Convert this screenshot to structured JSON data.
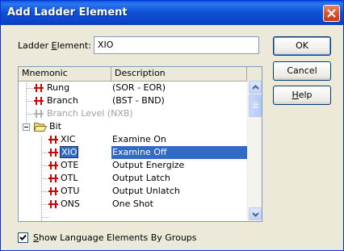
{
  "window": {
    "title": "Add Ladder Element"
  },
  "field": {
    "label_prefix": "Ladder ",
    "label_accel": "E",
    "label_suffix": "lement:",
    "value": "XIO"
  },
  "buttons": {
    "ok": "OK",
    "cancel": "Cancel",
    "help_accel": "H",
    "help_rest": "elp"
  },
  "list": {
    "col_mnemonic": "Mnemonic",
    "col_description": "Description",
    "rows": [
      {
        "mnemonic": "Rung",
        "description": "(SOR - EOR)",
        "enabled": true,
        "selected": false
      },
      {
        "mnemonic": "Branch",
        "description": "(BST - BND)",
        "enabled": true,
        "selected": false
      },
      {
        "mnemonic": "Branch Level (NXB)",
        "description": "",
        "enabled": false,
        "selected": false
      },
      {
        "mnemonic": "Bit",
        "description": "",
        "enabled": true,
        "selected": false,
        "folder": true
      },
      {
        "mnemonic": "XIC",
        "description": "Examine On",
        "enabled": true,
        "selected": false
      },
      {
        "mnemonic": "XIO",
        "description": "Examine Off",
        "enabled": true,
        "selected": true
      },
      {
        "mnemonic": "OTE",
        "description": "Output Energize",
        "enabled": true,
        "selected": false
      },
      {
        "mnemonic": "OTL",
        "description": "Output Latch",
        "enabled": true,
        "selected": false
      },
      {
        "mnemonic": "OTU",
        "description": "Output Unlatch",
        "enabled": true,
        "selected": false
      },
      {
        "mnemonic": "ONS",
        "description": "One Shot",
        "enabled": true,
        "selected": false
      }
    ]
  },
  "checkbox": {
    "accel": "S",
    "label_rest": "how Language Elements By Groups",
    "checked": true
  },
  "icons": {
    "close": "close-icon",
    "rung": "rung-icon",
    "folder": "open-folder-icon",
    "collapse": "minus-box-icon",
    "scroll_up": "chevron-up-icon",
    "scroll_down": "chevron-down-icon"
  },
  "colors": {
    "titlebar": "#0a4fd6",
    "selection": "#316ac5",
    "rung_icon": "#d00000"
  }
}
